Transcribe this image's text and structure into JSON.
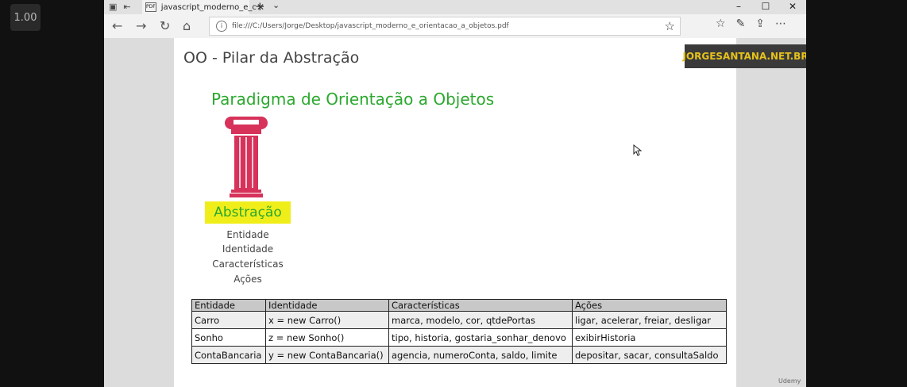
{
  "zoom_badge": "1.00",
  "browser": {
    "tab_title": "javascript_moderno_e_c",
    "url": "file:///C:/Users/Jorge/Desktop/javascript_moderno_e_orientacao_a_objetos.pdf"
  },
  "slide": {
    "title": "OO - Pilar da Abstração",
    "brand": "JORGESANTANA.NET.BR",
    "subtitle": "Paradigma de Orientação a Objetos",
    "pillar_label": "Abstração",
    "concepts": [
      "Entidade",
      "Identidade",
      "Características",
      "Ações"
    ],
    "table": {
      "headers": [
        "Entidade",
        "Identidade",
        "Características",
        "Ações"
      ],
      "rows": [
        [
          "Carro",
          "x = new Carro()",
          "marca, modelo, cor, qtdePortas",
          "ligar, acelerar, freiar, desligar"
        ],
        [
          "Sonho",
          "z = new Sonho()",
          "tipo, historia, gostaria_sonhar_denovo",
          "exibirHistoria"
        ],
        [
          "ContaBancaria",
          "y = new ContaBancaria()",
          "agencia, numeroConta, saldo, limite",
          "depositar, sacar, consultaSaldo"
        ]
      ]
    }
  },
  "watermark": "Udemy",
  "colors": {
    "accent_green": "#2ba82e",
    "highlight_yellow": "#f0ee1a",
    "pillar_red": "#d6325a",
    "brand_text": "#e6c21a"
  }
}
